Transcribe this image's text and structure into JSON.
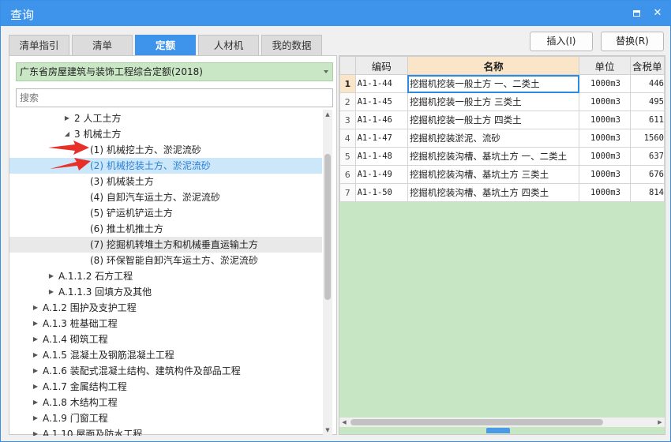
{
  "window": {
    "title": "查询"
  },
  "title_buttons": {
    "restore_icon": "restore-icon",
    "close_glyph": "✕"
  },
  "tabs": [
    {
      "label": "清单指引",
      "active": false
    },
    {
      "label": "清单",
      "active": false
    },
    {
      "label": "定额",
      "active": true
    },
    {
      "label": "人材机",
      "active": false
    },
    {
      "label": "我的数据",
      "active": false
    }
  ],
  "actions": {
    "insert_label": "插入(I)",
    "replace_label": "替换(R)"
  },
  "left": {
    "quota_library": "广东省房屋建筑与装饰工程综合定额(2018)",
    "search_placeholder": "搜索",
    "tree": [
      {
        "label": "2 人工土方",
        "indent": 3,
        "toggle": "collapsed"
      },
      {
        "label": "3 机械土方",
        "indent": 3,
        "toggle": "expanded"
      },
      {
        "label": "(1) 机械挖土方、淤泥流砂",
        "indent": 4,
        "toggle": "none"
      },
      {
        "label": "(2) 机械挖装土方、淤泥流砂",
        "indent": 4,
        "toggle": "none",
        "selected": true
      },
      {
        "label": "(3) 机械装土方",
        "indent": 4,
        "toggle": "none"
      },
      {
        "label": "(4) 自卸汽车运土方、淤泥流砂",
        "indent": 4,
        "toggle": "none"
      },
      {
        "label": "(5) 铲运机铲运土方",
        "indent": 4,
        "toggle": "none"
      },
      {
        "label": "(6) 推土机推土方",
        "indent": 4,
        "toggle": "none"
      },
      {
        "label": "(7) 挖掘机转堆土方和机械垂直运输土方",
        "indent": 4,
        "toggle": "none",
        "hover": true
      },
      {
        "label": "(8) 环保智能自卸汽车运土方、淤泥流砂",
        "indent": 4,
        "toggle": "none"
      },
      {
        "label": "A.1.1.2 石方工程",
        "indent": 2,
        "toggle": "collapsed"
      },
      {
        "label": "A.1.1.3 回填方及其他",
        "indent": 2,
        "toggle": "collapsed"
      },
      {
        "label": "A.1.2 围护及支护工程",
        "indent": 1,
        "toggle": "collapsed"
      },
      {
        "label": "A.1.3 桩基础工程",
        "indent": 1,
        "toggle": "collapsed"
      },
      {
        "label": "A.1.4 砌筑工程",
        "indent": 1,
        "toggle": "collapsed"
      },
      {
        "label": "A.1.5 混凝土及钢筋混凝土工程",
        "indent": 1,
        "toggle": "collapsed"
      },
      {
        "label": "A.1.6 装配式混凝土结构、建筑构件及部品工程",
        "indent": 1,
        "toggle": "collapsed"
      },
      {
        "label": "A.1.7 金属结构工程",
        "indent": 1,
        "toggle": "collapsed"
      },
      {
        "label": "A.1.8 木结构工程",
        "indent": 1,
        "toggle": "collapsed"
      },
      {
        "label": "A.1.9 门窗工程",
        "indent": 1,
        "toggle": "collapsed"
      },
      {
        "label": "A.1.10 屋面及防水工程",
        "indent": 1,
        "toggle": "collapsed"
      }
    ]
  },
  "grid": {
    "headers": [
      "",
      "编码",
      "名称",
      "单位",
      "含税单"
    ],
    "rows": [
      {
        "n": "1",
        "code": "A1-1-44",
        "name": "挖掘机挖装一般土方 一、二类土",
        "unit": "1000m3",
        "price": "446",
        "selected": true
      },
      {
        "n": "2",
        "code": "A1-1-45",
        "name": "挖掘机挖装一般土方 三类土",
        "unit": "1000m3",
        "price": "495"
      },
      {
        "n": "3",
        "code": "A1-1-46",
        "name": "挖掘机挖装一般土方 四类土",
        "unit": "1000m3",
        "price": "611"
      },
      {
        "n": "4",
        "code": "A1-1-47",
        "name": "挖掘机挖装淤泥、流砂",
        "unit": "1000m3",
        "price": "1560"
      },
      {
        "n": "5",
        "code": "A1-1-48",
        "name": "挖掘机挖装沟槽、基坑土方 一、二类土",
        "unit": "1000m3",
        "price": "637"
      },
      {
        "n": "6",
        "code": "A1-1-49",
        "name": "挖掘机挖装沟槽、基坑土方 三类土",
        "unit": "1000m3",
        "price": "676"
      },
      {
        "n": "7",
        "code": "A1-1-50",
        "name": "挖掘机挖装沟槽、基坑土方 四类土",
        "unit": "1000m3",
        "price": "814"
      }
    ]
  },
  "colors": {
    "accent": "#3d94ea",
    "selection": "#cce7fa",
    "header_highlight": "#fbe5c8",
    "panel_green": "#c7e7c4",
    "annotation_red": "#e8302a"
  }
}
